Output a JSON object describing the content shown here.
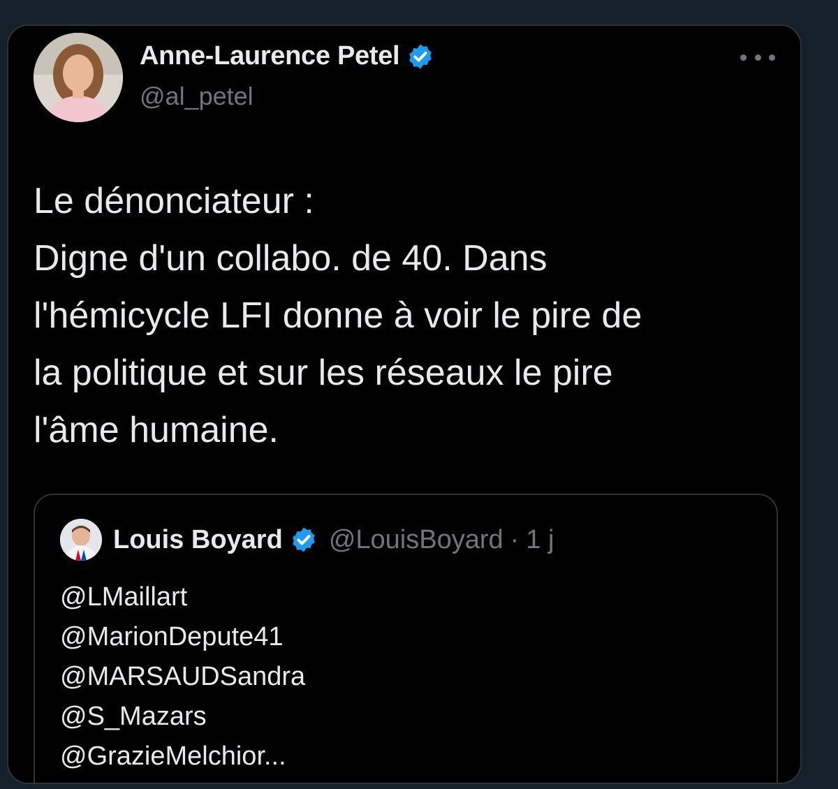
{
  "tweet": {
    "author": {
      "display_name": "Anne-Laurence Petel",
      "handle": "@al_petel",
      "verified_icon": "verified-badge-icon",
      "avatar": "profile-photo"
    },
    "more_icon": "more-options-icon",
    "text_lines": [
      "Le dénonciateur :",
      "Digne d'un collabo. de 40. Dans",
      "l'hémicycle LFI donne à voir le pire de",
      "la politique et sur les réseaux le pire",
      "l'âme humaine."
    ]
  },
  "quoted_tweet": {
    "author": {
      "display_name": "Louis Boyard",
      "handle": "@LouisBoyard",
      "separator": "·",
      "time": "1 j",
      "verified_icon": "verified-badge-icon",
      "avatar": "profile-photo"
    },
    "text_lines": [
      "@LMaillart",
      "@MarionDepute41",
      "@MARSAUDSandra",
      "@S_Mazars",
      "@GrazieMelchior..."
    ]
  },
  "colors": {
    "background": "#15202b",
    "card": "#000000",
    "border": "#2f3336",
    "primary_text": "#e7e9ea",
    "secondary_text": "#71767b",
    "verified": "#1d9bf0"
  }
}
